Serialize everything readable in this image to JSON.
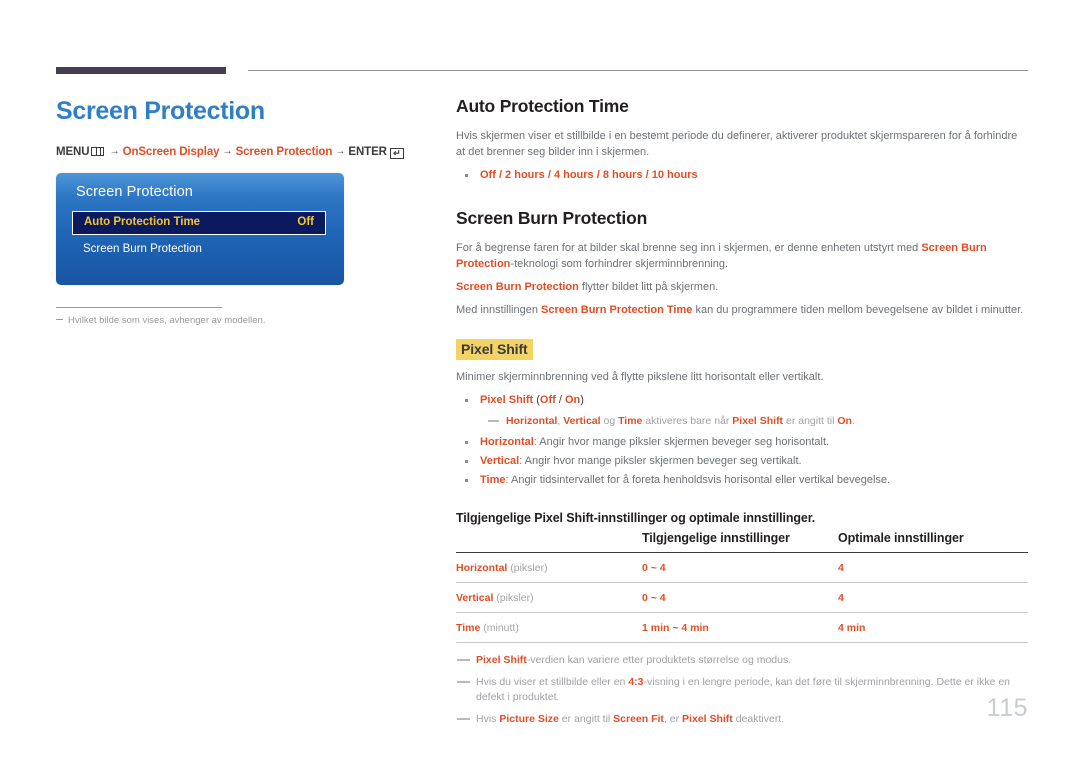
{
  "header": {
    "rule_color_thick": "#453d52",
    "rule_color_thin": "#8f8f95"
  },
  "left": {
    "chapter_title": "Screen Protection",
    "menu_path": {
      "menu_label": "MENU",
      "menu_icon": "menu-grid-icon",
      "arrow": "→",
      "step1": "OnScreen Display",
      "step2": "Screen Protection",
      "enter_label": "ENTER",
      "enter_icon": "enter-key-icon",
      "enter_glyph": "↵"
    },
    "osd": {
      "title": "Screen Protection",
      "selected_row_label": "Auto Protection Time",
      "selected_row_value": "Off",
      "row2_label": "Screen Burn Protection",
      "accent_color": "#f2c531",
      "panel_color": "#2c76c4",
      "selected_bg": "#0b1a5e"
    },
    "note": "Hvilket bilde som vises, avhenger av modellen."
  },
  "right": {
    "section1": {
      "heading": "Auto Protection Time",
      "paragraph": "Hvis skjermen viser et stillbilde i en bestemt periode du definerer, aktiverer produktet skjermspareren for å forhindre at det brenner seg bilder inn i skjermen.",
      "bullet_options": "Off / 2 hours / 4 hours / 8 hours / 10 hours"
    },
    "section2": {
      "heading": "Screen Burn Protection",
      "p1_a": "For å begrense faren for at bilder skal brenne seg inn i skjermen, er denne enheten utstyrt med ",
      "p1_b": "Screen Burn Protection",
      "p1_c": "-teknologi som forhindrer skjerminnbrenning.",
      "p2_a": "Screen Burn Protection",
      "p2_b": " flytter bildet litt på skjermen.",
      "p3_a": "Med innstillingen ",
      "p3_b": "Screen Burn Protection Time",
      "p3_c": " kan du programmere tiden mellom bevegelsene av bildet i minutter."
    },
    "pixel_shift": {
      "heading": "Pixel Shift",
      "highlight_color": "#f3d266",
      "intro": "Minimer skjerminnbrenning ved å flytte pikslene litt horisontalt eller vertikalt.",
      "bullet1_label": "Pixel Shift",
      "bullet1_options_open": " (",
      "bullet1_opt1": "Off",
      "bullet1_sep": " / ",
      "bullet1_opt2": "On",
      "bullet1_options_close": ")",
      "subnote": {
        "a": "Horizontal",
        "b": ", ",
        "c": "Vertical",
        "d": " og ",
        "e": "Time",
        "f": " aktiveres bare når ",
        "g": "Pixel Shift",
        "h": " er angitt til ",
        "i": "On",
        "j": "."
      },
      "bullet2_key": "Horizontal",
      "bullet2_text": ": Angir hvor mange piksler skjermen beveger seg horisontalt.",
      "bullet3_key": "Vertical",
      "bullet3_text": ": Angir hvor mange piksler skjermen beveger seg vertikalt.",
      "bullet4_key": "Time",
      "bullet4_text": ": Angir tidsintervallet for å foreta henholdsvis horisontal eller vertikal bevegelse."
    },
    "table": {
      "title": "Tilgjengelige Pixel Shift-innstillinger og optimale innstillinger.",
      "headers": [
        "",
        "Tilgjengelige innstillinger",
        "Optimale innstillinger"
      ],
      "rows": [
        {
          "key": "Horizontal",
          "unit": " (piksler)",
          "available": "0 ~ 4",
          "optimal": "4"
        },
        {
          "key": "Vertical",
          "unit": " (piksler)",
          "available": "0 ~ 4",
          "optimal": "4"
        },
        {
          "key": "Time",
          "unit": " (minutt)",
          "available": "1 min ~ 4 min",
          "optimal": "4 min"
        }
      ]
    },
    "footnotes": [
      {
        "parts": [
          {
            "t": "Pixel Shift",
            "accent": true
          },
          {
            "t": "-verdien kan variere etter produktets størrelse og modus.",
            "accent": false
          }
        ]
      },
      {
        "parts": [
          {
            "t": "Hvis du viser et stillbilde eller en ",
            "accent": false
          },
          {
            "t": "4:3",
            "accent": true
          },
          {
            "t": "-visning i en lengre periode, kan det føre til skjerminnbrenning. Dette er ikke en defekt i produktet.",
            "accent": false
          }
        ]
      },
      {
        "parts": [
          {
            "t": "Hvis ",
            "accent": false
          },
          {
            "t": "Picture Size",
            "accent": true
          },
          {
            "t": " er angitt til ",
            "accent": false
          },
          {
            "t": "Screen Fit",
            "accent": true
          },
          {
            "t": ", er ",
            "accent": false
          },
          {
            "t": "Pixel Shift",
            "accent": true
          },
          {
            "t": " deaktivert.",
            "accent": false
          }
        ]
      }
    ]
  },
  "page_number": "115",
  "accent_color": "#e04e25",
  "title_color": "#2f7fc6"
}
